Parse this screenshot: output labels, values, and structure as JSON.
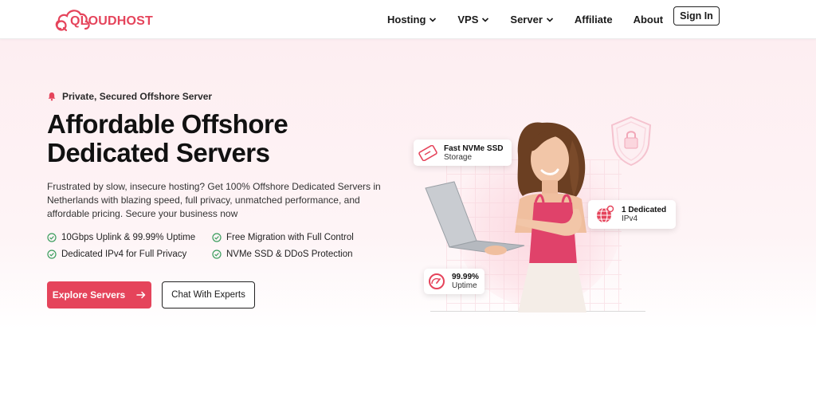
{
  "brand": {
    "name": "QLOUDHOST",
    "accent": "#e5445b"
  },
  "nav": {
    "items": [
      {
        "label": "Hosting",
        "dropdown": true
      },
      {
        "label": "VPS",
        "dropdown": true
      },
      {
        "label": "Server",
        "dropdown": true
      },
      {
        "label": "Affiliate",
        "dropdown": false
      },
      {
        "label": "About",
        "dropdown": false
      }
    ],
    "signin_label": "Sign In"
  },
  "hero": {
    "tagline": "Private, Secured Offshore Server",
    "headline_line1": "Affordable Offshore",
    "headline_line2": "Dedicated Servers",
    "description": "Frustrated by slow, insecure hosting? Get 100% Offshore Dedicated Servers in Netherlands with blazing speed, full privacy, unmatched performance, and affordable pricing. Secure your business now",
    "features": [
      "10Gbps Uplink & 99.99% Uptime",
      "Free Migration with Full Control",
      "Dedicated IPv4 for Full Privacy",
      "NVMe SSD & DDoS Protection"
    ],
    "primary_button": "Explore Servers",
    "secondary_button": "Chat With Experts"
  },
  "badges": {
    "ssd_title": "Fast NVMe SSD",
    "ssd_sub": "Storage",
    "ip_title": "1 Dedicated",
    "ip_sub": "IPv4",
    "uptime_title": "99.99%",
    "uptime_sub": "Uptime"
  },
  "icons": {
    "tagline": "bell-icon",
    "feature": "check-circle-icon",
    "ssd": "ssd-drive-icon",
    "ip": "globe-icon",
    "uptime": "speedometer-icon",
    "shield": "shield-lock-icon"
  }
}
